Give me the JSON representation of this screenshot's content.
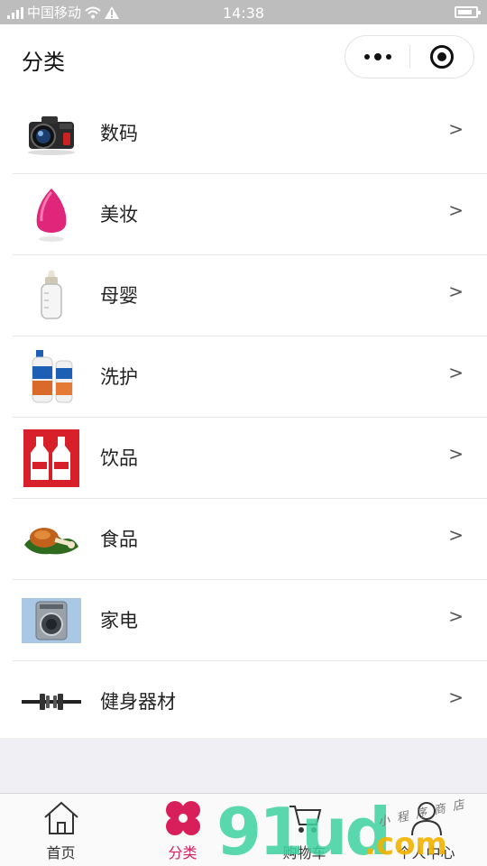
{
  "status_bar": {
    "carrier": "中国移动",
    "time": "14:38"
  },
  "nav": {
    "title": "分类"
  },
  "categories": [
    {
      "label": "数码",
      "icon": "camera-icon",
      "arrow": ">"
    },
    {
      "label": "美妆",
      "icon": "makeup-sponge-icon",
      "arrow": ">"
    },
    {
      "label": "母婴",
      "icon": "baby-bottle-icon",
      "arrow": ">"
    },
    {
      "label": "洗护",
      "icon": "shampoo-icon",
      "arrow": ">"
    },
    {
      "label": "饮品",
      "icon": "drink-bottles-icon",
      "arrow": ">"
    },
    {
      "label": "食品",
      "icon": "food-drumstick-icon",
      "arrow": ">"
    },
    {
      "label": "家电",
      "icon": "washing-machine-icon",
      "arrow": ">"
    },
    {
      "label": "健身器材",
      "icon": "dumbbell-icon",
      "arrow": ">"
    }
  ],
  "tabbar": {
    "items": [
      {
        "label": "首页",
        "icon": "home-icon",
        "active": false
      },
      {
        "label": "分类",
        "icon": "category-icon",
        "active": true
      },
      {
        "label": "购物车",
        "icon": "cart-icon",
        "active": false
      },
      {
        "label": "个人中心",
        "icon": "user-icon",
        "active": false
      }
    ]
  },
  "watermark": {
    "brand": "91ud",
    "domain": ".com",
    "handwritten": "小程序商店"
  },
  "colors": {
    "accent": "#d81e5b",
    "status_bar_bg": "#bdbdbd",
    "watermark_green": "#3fd3a0",
    "watermark_yellow": "#f2b300"
  }
}
